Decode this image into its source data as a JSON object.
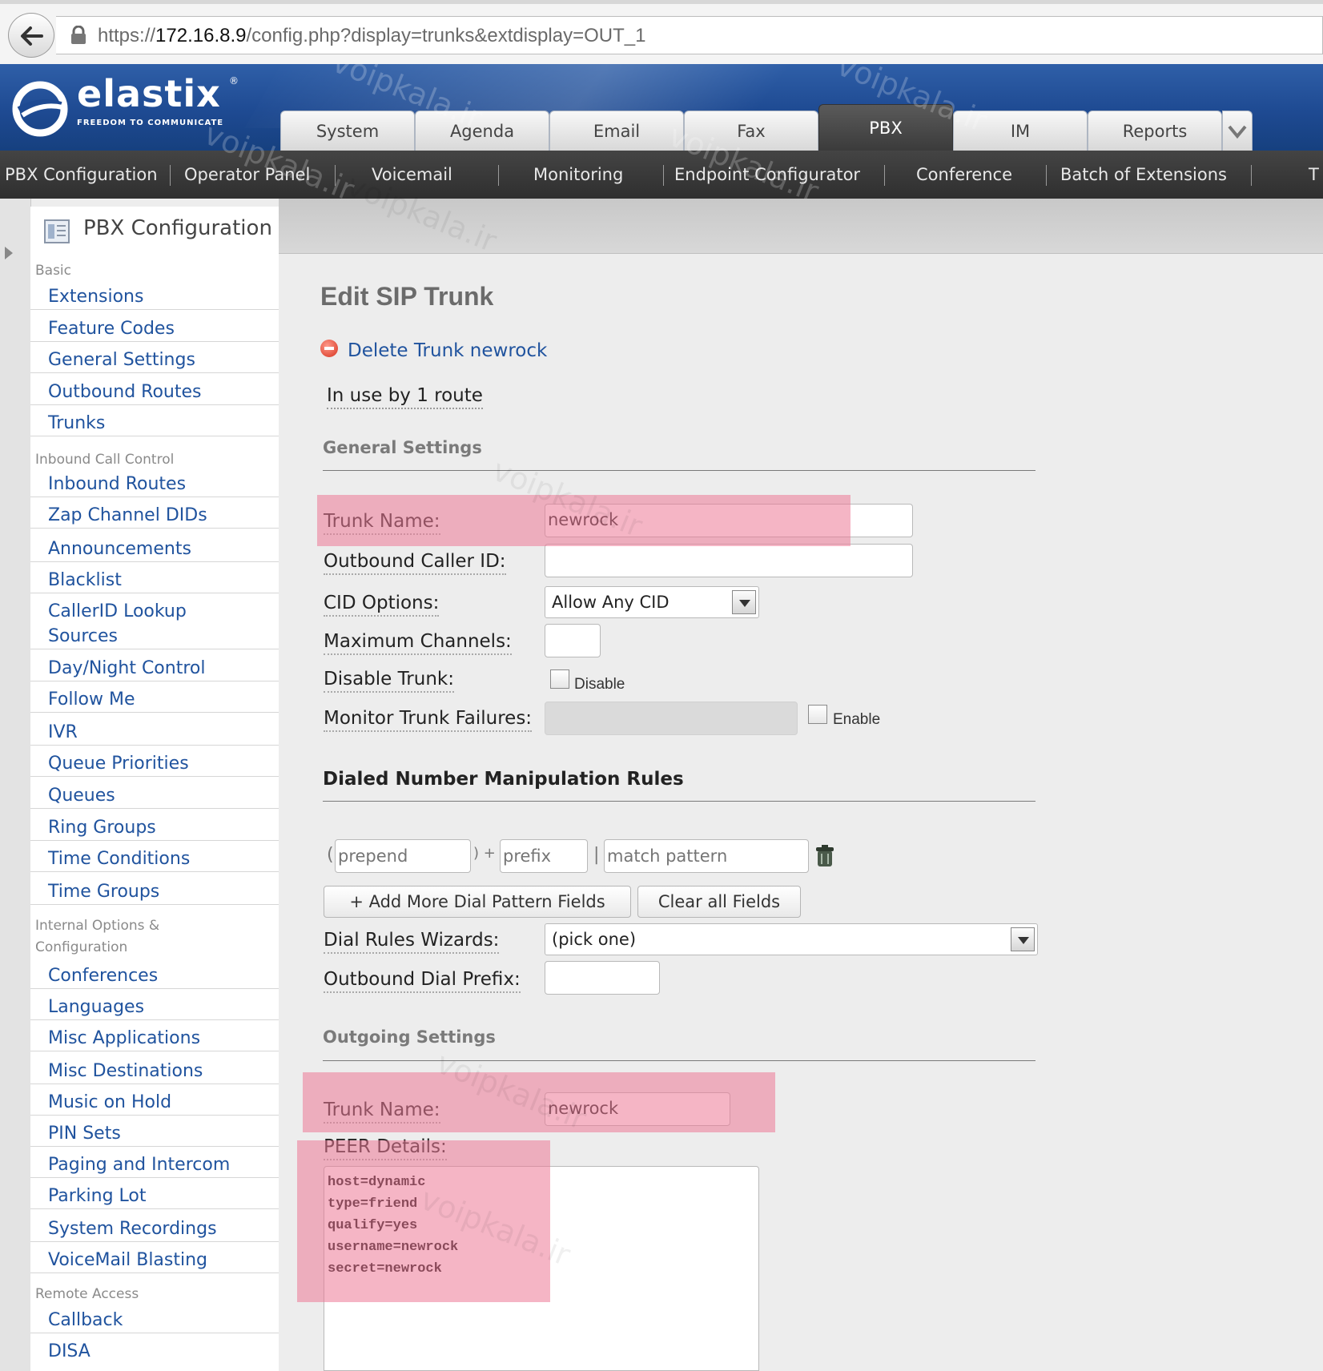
{
  "browser": {
    "url_prefix": "https://",
    "url_host": "172.16.8.9",
    "url_path": "/config.php?display=trunks&extdisplay=OUT_1"
  },
  "brand": {
    "logo_text": "elastix",
    "logo_mark": "®",
    "tagline": "FREEDOM TO COMMUNICATE"
  },
  "top_tabs": [
    "System",
    "Agenda",
    "Email",
    "Fax",
    "PBX",
    "IM",
    "Reports"
  ],
  "active_tab": "PBX",
  "sub_menu": [
    "PBX Configuration",
    "Operator Panel",
    "Voicemail",
    "Monitoring",
    "Endpoint Configurator",
    "Conference",
    "Batch of Extensions",
    "T"
  ],
  "sidebar": {
    "title": "PBX Configuration",
    "categories": {
      "basic": "Basic",
      "inbound": "Inbound Call Control",
      "internal_1": "Internal Options &",
      "internal_2": "Configuration",
      "remote": "Remote Access"
    },
    "basic_items": [
      "Extensions",
      "Feature Codes",
      "General Settings",
      "Outbound Routes",
      "Trunks"
    ],
    "inbound_items": [
      "Inbound Routes",
      "Zap Channel DIDs",
      "Announcements",
      "Blacklist",
      "CallerID Lookup",
      "Sources",
      "Day/Night Control",
      "Follow Me",
      "IVR",
      "Queue Priorities",
      "Queues",
      "Ring Groups",
      "Time Conditions",
      "Time Groups"
    ],
    "internal_items": [
      "Conferences",
      "Languages",
      "Misc Applications",
      "Misc Destinations",
      "Music on Hold",
      "PIN Sets",
      "Paging and Intercom",
      "Parking Lot",
      "System Recordings",
      "VoiceMail Blasting"
    ],
    "remote_items": [
      "Callback",
      "DISA"
    ]
  },
  "page": {
    "title": "Edit SIP Trunk",
    "delete_link": "Delete Trunk newrock",
    "in_use": "In use by 1 route"
  },
  "general": {
    "heading": "General Settings",
    "trunk_name_label": "Trunk Name:",
    "trunk_name_value": "newrock",
    "outbound_cid_label": "Outbound Caller ID:",
    "outbound_cid_value": "",
    "cid_options_label": "CID Options:",
    "cid_options_value": "Allow Any CID",
    "max_channels_label": "Maximum Channels:",
    "max_channels_value": "",
    "disable_trunk_label": "Disable Trunk:",
    "disable_checkbox_label": "Disable",
    "monitor_label": "Monitor Trunk Failures:",
    "enable_checkbox_label": "Enable"
  },
  "dial_rules": {
    "heading": "Dialed Number Manipulation Rules",
    "prepend_placeholder": "prepend",
    "prefix_placeholder": "prefix",
    "match_placeholder": "match pattern",
    "open_paren": "(",
    "close_plus": ") +",
    "pipe": "|",
    "add_button": "+ Add More Dial Pattern Fields",
    "clear_button": "Clear all Fields",
    "wizards_label": "Dial Rules Wizards:",
    "wizards_value": "(pick one)",
    "outbound_prefix_label": "Outbound Dial Prefix:",
    "outbound_prefix_value": ""
  },
  "outgoing": {
    "heading": "Outgoing Settings",
    "trunk_name_label": "Trunk Name:",
    "trunk_name_value": "newrock",
    "peer_label": "PEER Details:",
    "peer_lines": [
      "host=dynamic",
      "type=friend",
      "qualify=yes",
      "username=newrock",
      "secret=newrock"
    ]
  },
  "watermark": "voipkala.ir",
  "colors": {
    "link": "#20539e",
    "header_blue": "#1e4a92",
    "highlight": "#ec7896",
    "submenu_bg": "#3a3a3a"
  }
}
